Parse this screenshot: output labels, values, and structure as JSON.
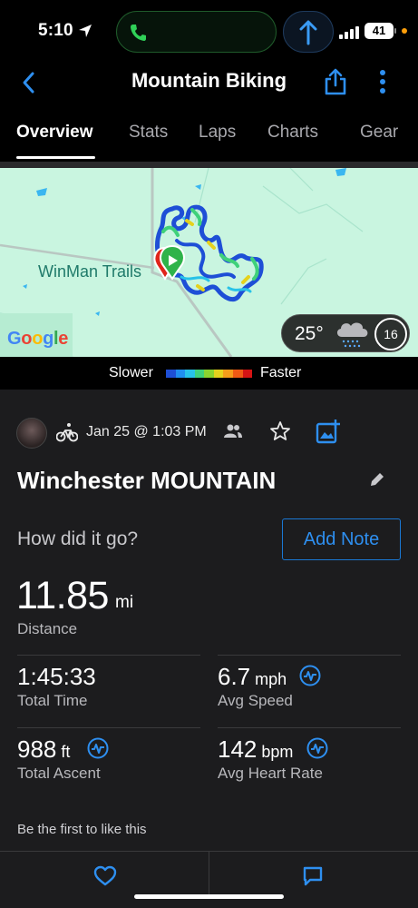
{
  "status_bar": {
    "time": "5:10",
    "battery": "41"
  },
  "header": {
    "title": "Mountain Biking"
  },
  "tabs": [
    {
      "label": "Overview",
      "active": true
    },
    {
      "label": "Stats",
      "active": false
    },
    {
      "label": "Laps",
      "active": false
    },
    {
      "label": "Charts",
      "active": false
    },
    {
      "label": "Gear",
      "active": false
    }
  ],
  "map": {
    "place_label": "WinMan Trails",
    "attribution": "Google",
    "weather": {
      "temperature": "25°",
      "wind": "16",
      "icon": "snow-cloud-icon"
    }
  },
  "legend": {
    "slower": "Slower",
    "faster": "Faster",
    "colors": [
      "#1e4fd6",
      "#1f8ef0",
      "#27c2e8",
      "#3fd17a",
      "#8bd42f",
      "#e5d21d",
      "#f59d1a",
      "#f05a14",
      "#d61414"
    ]
  },
  "activity": {
    "date": "Jan 25 @ 1:03 PM",
    "name": "Winchester MOUNTAIN",
    "prompt": "How did it go?",
    "add_note": "Add Note",
    "distance": {
      "value": "11.85",
      "unit": "mi",
      "label": "Distance"
    },
    "stats": [
      {
        "value": "1:45:33",
        "unit": "",
        "label": "Total Time"
      },
      {
        "value": "6.7",
        "unit": "mph",
        "label": "Avg Speed"
      },
      {
        "value": "988",
        "unit": "ft",
        "label": "Total Ascent"
      },
      {
        "value": "142",
        "unit": "bpm",
        "label": "Avg Heart Rate"
      }
    ],
    "like_text": "Be the first to like this"
  },
  "colors": {
    "accent": "#2e8ff0",
    "background": "#1c1c1e",
    "map": "#c9f5e0"
  }
}
